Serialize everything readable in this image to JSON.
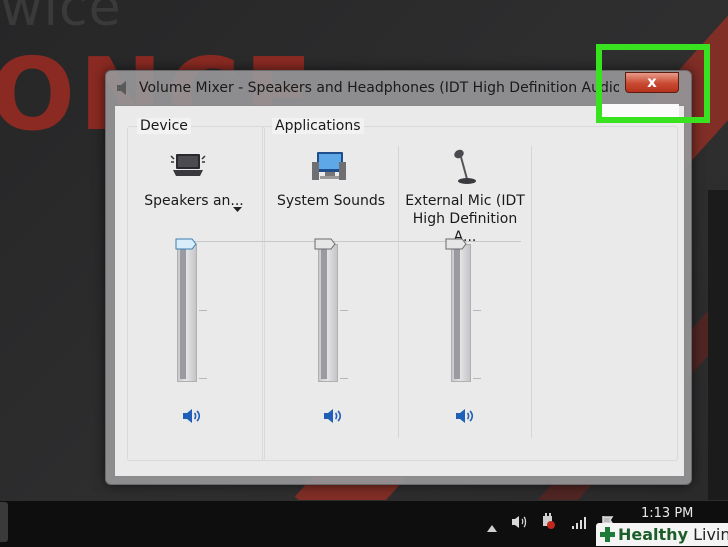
{
  "window": {
    "title": "Volume Mixer - Speakers and Headphones (IDT High Definition Audio C...",
    "close_label": "x"
  },
  "mixer": {
    "device_label": "Device",
    "applications_label": "Applications",
    "channels": [
      {
        "name": "Speakers an...",
        "has_dropdown": true,
        "icon": "speakers-icon",
        "level_percent": 100
      },
      {
        "name": "System Sounds",
        "has_dropdown": false,
        "icon": "system-sounds-icon",
        "level_percent": 100
      },
      {
        "name": "External Mic (IDT High Definition A...",
        "line1": "External Mic (IDT",
        "line2": "High Definition A...",
        "has_dropdown": false,
        "icon": "microphone-icon",
        "level_percent": 100
      }
    ]
  },
  "background": {
    "word_top": "wice",
    "word_big": "ONCE"
  },
  "taskbar": {
    "clock": "1:13 PM"
  },
  "watermark": {
    "brand_a": "Healthy",
    "brand_b": "Living"
  },
  "colors": {
    "highlight": "#39e21f",
    "close_button": "#c94a32",
    "accent_blue": "#1f5fb8"
  }
}
